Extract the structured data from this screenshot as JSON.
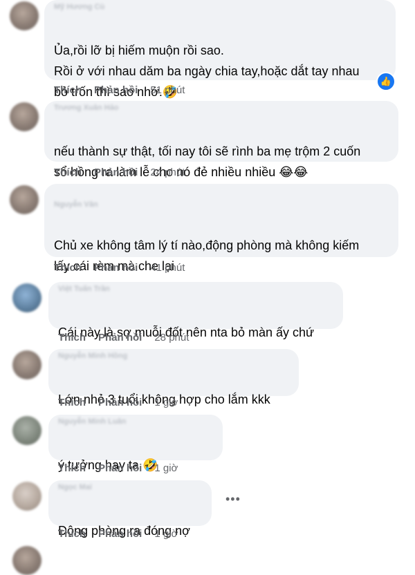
{
  "comments": [
    {
      "author": "Mỹ Hương Cù",
      "lines": "Ủa,rồi lỡ bị hiếm muộn rồi sao.\nRồi ở với nhau dăm ba ngày chia tay,hoặc dắt tay nhau\nbỏ trốn thì sao nhở.",
      "emoji": "🤣",
      "like": "Thích",
      "reply": "Phản hồi",
      "time": "51 phút",
      "like_badge_icon": "thumbs-up-icon"
    },
    {
      "author": "Trương Xuân Hảo",
      "lines": "nếu thành sự thật, tối nay tôi sẽ rình ba mẹ trộm 2 cuốn\nsổ hồng ra làm lễ cho nó đẻ nhiều nhiều",
      "emoji": "😂😂",
      "like": "Thích",
      "reply": "Phản hồi",
      "time": "24 phút"
    },
    {
      "author": "Nguyễn Văn",
      "lines": "Chủ xe không tâm lý tí nào,động phòng mà không kiếm\nlấy cái rèm mà che lại",
      "like": "Thích",
      "reply": "Phản hồi",
      "time": "41 phút"
    },
    {
      "author": "Việt Tuấn Trần",
      "lines": "Cái này là sợ muỗi đốt nên nta bỏ màn ấy chứ",
      "like": "Thích",
      "reply": "Phản hồi",
      "time": "28 phút"
    },
    {
      "author": "Nguyễn Minh Hồng",
      "lines": "Lớn nhỏ 3 tuổi không hợp cho lắm kkk",
      "like": "Thích",
      "reply": "Phản hồi",
      "time": "1 giờ"
    },
    {
      "author": "Nguyễn Minh Luân",
      "lines": "ý tưởng hay ta",
      "emoji": "🤣",
      "like": "Thích",
      "reply": "Phản hồi",
      "time": "1 giờ"
    },
    {
      "author": "Ngọc Mai",
      "lines": "Động phòng ra đóng nợ",
      "like": "Thích",
      "reply": "Phản hồi",
      "time": "1 giờ",
      "more_icon": "more-options-icon"
    }
  ],
  "colors": {
    "bubble": "#f0f2f5",
    "text": "#050505",
    "meta": "#65676b",
    "like_badge": "#1877f2"
  }
}
